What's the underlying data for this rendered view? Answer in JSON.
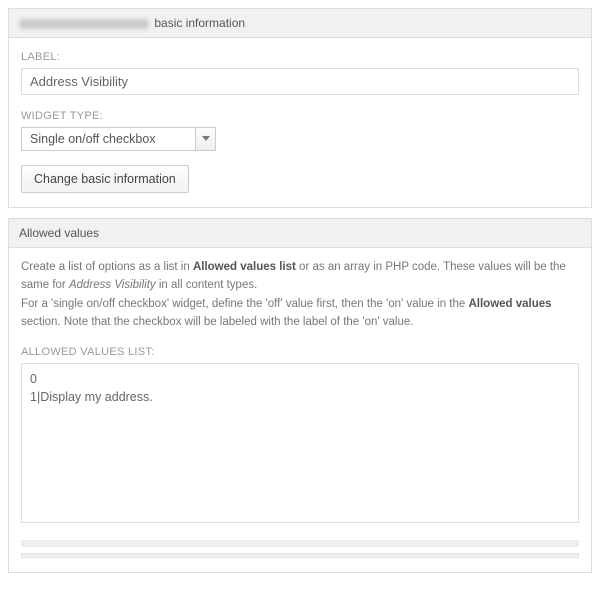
{
  "panel1": {
    "header_suffix": "basic information",
    "label_field_label": "LABEL:",
    "label_value": "Address Visibility",
    "widget_field_label": "WIDGET TYPE:",
    "widget_value": "Single on/off checkbox",
    "button_label": "Change basic information"
  },
  "panel2": {
    "header": "Allowed values",
    "desc_part1": "Create a list of options as a list in ",
    "desc_bold1": "Allowed values list",
    "desc_part2": " or as an array in PHP code. These values will be the same for ",
    "desc_em1": "Address Visibility",
    "desc_part3": " in all content types.",
    "desc_part4": "For a 'single on/off checkbox' widget, define the 'off' value first, then the 'on' value in the ",
    "desc_bold2": "Allowed values",
    "desc_part5": " section. Note that the checkbox will be labeled with the label of the 'on' value.",
    "allowed_values_label": "ALLOWED VALUES LIST:",
    "allowed_values_text": "0\n1|Display my address."
  }
}
